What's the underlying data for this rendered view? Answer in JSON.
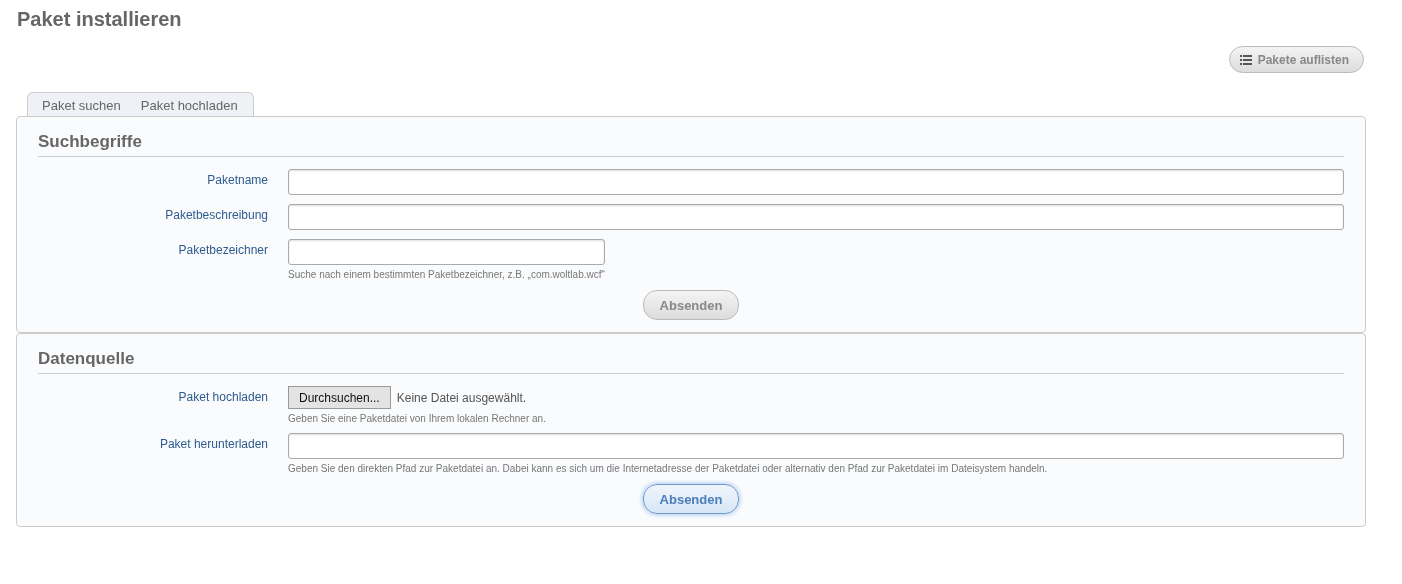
{
  "title": "Paket installieren",
  "list_button": {
    "label": "Pakete auflisten"
  },
  "tabs": [
    {
      "label": "Paket suchen",
      "selected": false
    },
    {
      "label": "Paket hochladen",
      "selected": false
    }
  ],
  "sections": [
    {
      "heading": "Suchbegriffe",
      "fields": [
        {
          "kind": "text",
          "label": "Paketname"
        },
        {
          "kind": "text",
          "label": "Paketbeschreibung"
        },
        {
          "kind": "identifier",
          "label": "Paketbezeichner",
          "hint": "Suche nach einem bestimmten Paketbezeichner, z.B. „com.woltlab.wcf“"
        }
      ],
      "submit": {
        "label": "Absenden",
        "focused": false
      }
    },
    {
      "heading": "Datenquelle",
      "fields": [
        {
          "kind": "file",
          "label": "Paket hochladen",
          "button": "Durchsuchen...",
          "status": "Keine Datei ausgewählt.",
          "hint": "Geben Sie eine Paketdatei von Ihrem lokalen Rechner an."
        },
        {
          "kind": "text",
          "label": "Paket herunterladen",
          "hint": "Geben Sie den direkten Pfad zur Paketdatei an. Dabei kann es sich um die Internetadresse der Paketdatei oder alternativ den Pfad zur Paketdatei im Dateisystem handeln."
        }
      ],
      "submit": {
        "label": "Absenden",
        "focused": true
      }
    }
  ]
}
